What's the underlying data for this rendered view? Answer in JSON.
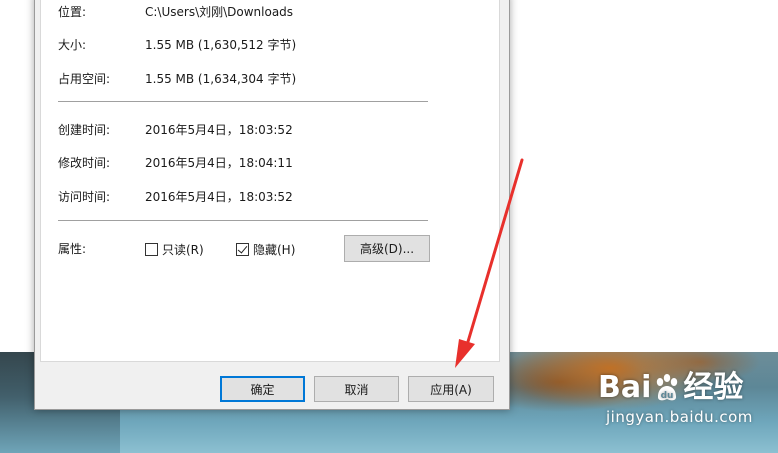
{
  "properties": {
    "location_label": "位置:",
    "location_value": "C:\\Users\\刘刚\\Downloads",
    "size_label": "大小:",
    "size_value": "1.55 MB (1,630,512 字节)",
    "disk_size_label": "占用空间:",
    "disk_size_value": "1.55 MB (1,634,304 字节)",
    "created_label": "创建时间:",
    "created_value": "2016年5月4日，18:03:52",
    "modified_label": "修改时间:",
    "modified_value": "2016年5月4日，18:04:11",
    "accessed_label": "访问时间:",
    "accessed_value": "2016年5月4日，18:03:52",
    "attributes_label": "属性:",
    "readonly_label": "只读(R)",
    "readonly_checked": false,
    "hidden_label": "隐藏(H)",
    "hidden_checked": true,
    "advanced_button": "高级(D)..."
  },
  "footer": {
    "ok_button": "确定",
    "cancel_button": "取消",
    "apply_button": "应用(A)"
  },
  "watermark": {
    "brand_left": "Bai",
    "brand_right": "经验",
    "url": "jingyan.baidu.com"
  },
  "colors": {
    "annotation_arrow": "#e8302c",
    "focus_border": "#0078d7"
  },
  "icons": {
    "readonly_checkbox": "checkbox-empty",
    "hidden_checkbox": "checkbox-checked",
    "annotation": "red-arrow",
    "watermark_logo": "baidu-paw"
  }
}
